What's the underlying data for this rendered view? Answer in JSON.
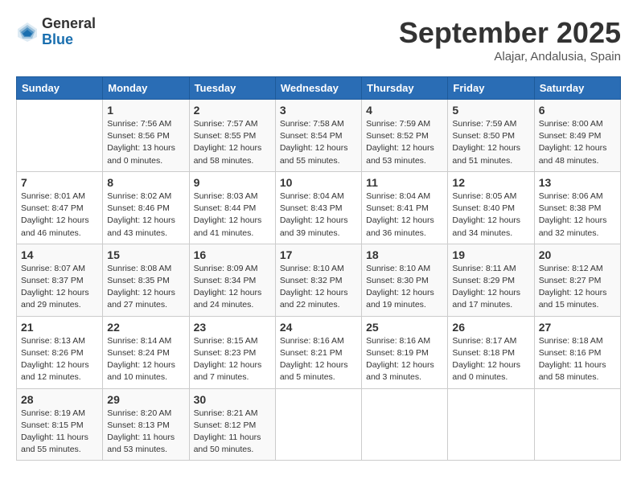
{
  "header": {
    "logo_general": "General",
    "logo_blue": "Blue",
    "month": "September 2025",
    "location": "Alajar, Andalusia, Spain"
  },
  "weekdays": [
    "Sunday",
    "Monday",
    "Tuesday",
    "Wednesday",
    "Thursday",
    "Friday",
    "Saturday"
  ],
  "weeks": [
    [
      {
        "day": "",
        "info": ""
      },
      {
        "day": "1",
        "info": "Sunrise: 7:56 AM\nSunset: 8:56 PM\nDaylight: 13 hours\nand 0 minutes."
      },
      {
        "day": "2",
        "info": "Sunrise: 7:57 AM\nSunset: 8:55 PM\nDaylight: 12 hours\nand 58 minutes."
      },
      {
        "day": "3",
        "info": "Sunrise: 7:58 AM\nSunset: 8:54 PM\nDaylight: 12 hours\nand 55 minutes."
      },
      {
        "day": "4",
        "info": "Sunrise: 7:59 AM\nSunset: 8:52 PM\nDaylight: 12 hours\nand 53 minutes."
      },
      {
        "day": "5",
        "info": "Sunrise: 7:59 AM\nSunset: 8:50 PM\nDaylight: 12 hours\nand 51 minutes."
      },
      {
        "day": "6",
        "info": "Sunrise: 8:00 AM\nSunset: 8:49 PM\nDaylight: 12 hours\nand 48 minutes."
      }
    ],
    [
      {
        "day": "7",
        "info": "Sunrise: 8:01 AM\nSunset: 8:47 PM\nDaylight: 12 hours\nand 46 minutes."
      },
      {
        "day": "8",
        "info": "Sunrise: 8:02 AM\nSunset: 8:46 PM\nDaylight: 12 hours\nand 43 minutes."
      },
      {
        "day": "9",
        "info": "Sunrise: 8:03 AM\nSunset: 8:44 PM\nDaylight: 12 hours\nand 41 minutes."
      },
      {
        "day": "10",
        "info": "Sunrise: 8:04 AM\nSunset: 8:43 PM\nDaylight: 12 hours\nand 39 minutes."
      },
      {
        "day": "11",
        "info": "Sunrise: 8:04 AM\nSunset: 8:41 PM\nDaylight: 12 hours\nand 36 minutes."
      },
      {
        "day": "12",
        "info": "Sunrise: 8:05 AM\nSunset: 8:40 PM\nDaylight: 12 hours\nand 34 minutes."
      },
      {
        "day": "13",
        "info": "Sunrise: 8:06 AM\nSunset: 8:38 PM\nDaylight: 12 hours\nand 32 minutes."
      }
    ],
    [
      {
        "day": "14",
        "info": "Sunrise: 8:07 AM\nSunset: 8:37 PM\nDaylight: 12 hours\nand 29 minutes."
      },
      {
        "day": "15",
        "info": "Sunrise: 8:08 AM\nSunset: 8:35 PM\nDaylight: 12 hours\nand 27 minutes."
      },
      {
        "day": "16",
        "info": "Sunrise: 8:09 AM\nSunset: 8:34 PM\nDaylight: 12 hours\nand 24 minutes."
      },
      {
        "day": "17",
        "info": "Sunrise: 8:10 AM\nSunset: 8:32 PM\nDaylight: 12 hours\nand 22 minutes."
      },
      {
        "day": "18",
        "info": "Sunrise: 8:10 AM\nSunset: 8:30 PM\nDaylight: 12 hours\nand 19 minutes."
      },
      {
        "day": "19",
        "info": "Sunrise: 8:11 AM\nSunset: 8:29 PM\nDaylight: 12 hours\nand 17 minutes."
      },
      {
        "day": "20",
        "info": "Sunrise: 8:12 AM\nSunset: 8:27 PM\nDaylight: 12 hours\nand 15 minutes."
      }
    ],
    [
      {
        "day": "21",
        "info": "Sunrise: 8:13 AM\nSunset: 8:26 PM\nDaylight: 12 hours\nand 12 minutes."
      },
      {
        "day": "22",
        "info": "Sunrise: 8:14 AM\nSunset: 8:24 PM\nDaylight: 12 hours\nand 10 minutes."
      },
      {
        "day": "23",
        "info": "Sunrise: 8:15 AM\nSunset: 8:23 PM\nDaylight: 12 hours\nand 7 minutes."
      },
      {
        "day": "24",
        "info": "Sunrise: 8:16 AM\nSunset: 8:21 PM\nDaylight: 12 hours\nand 5 minutes."
      },
      {
        "day": "25",
        "info": "Sunrise: 8:16 AM\nSunset: 8:19 PM\nDaylight: 12 hours\nand 3 minutes."
      },
      {
        "day": "26",
        "info": "Sunrise: 8:17 AM\nSunset: 8:18 PM\nDaylight: 12 hours\nand 0 minutes."
      },
      {
        "day": "27",
        "info": "Sunrise: 8:18 AM\nSunset: 8:16 PM\nDaylight: 11 hours\nand 58 minutes."
      }
    ],
    [
      {
        "day": "28",
        "info": "Sunrise: 8:19 AM\nSunset: 8:15 PM\nDaylight: 11 hours\nand 55 minutes."
      },
      {
        "day": "29",
        "info": "Sunrise: 8:20 AM\nSunset: 8:13 PM\nDaylight: 11 hours\nand 53 minutes."
      },
      {
        "day": "30",
        "info": "Sunrise: 8:21 AM\nSunset: 8:12 PM\nDaylight: 11 hours\nand 50 minutes."
      },
      {
        "day": "",
        "info": ""
      },
      {
        "day": "",
        "info": ""
      },
      {
        "day": "",
        "info": ""
      },
      {
        "day": "",
        "info": ""
      }
    ]
  ]
}
